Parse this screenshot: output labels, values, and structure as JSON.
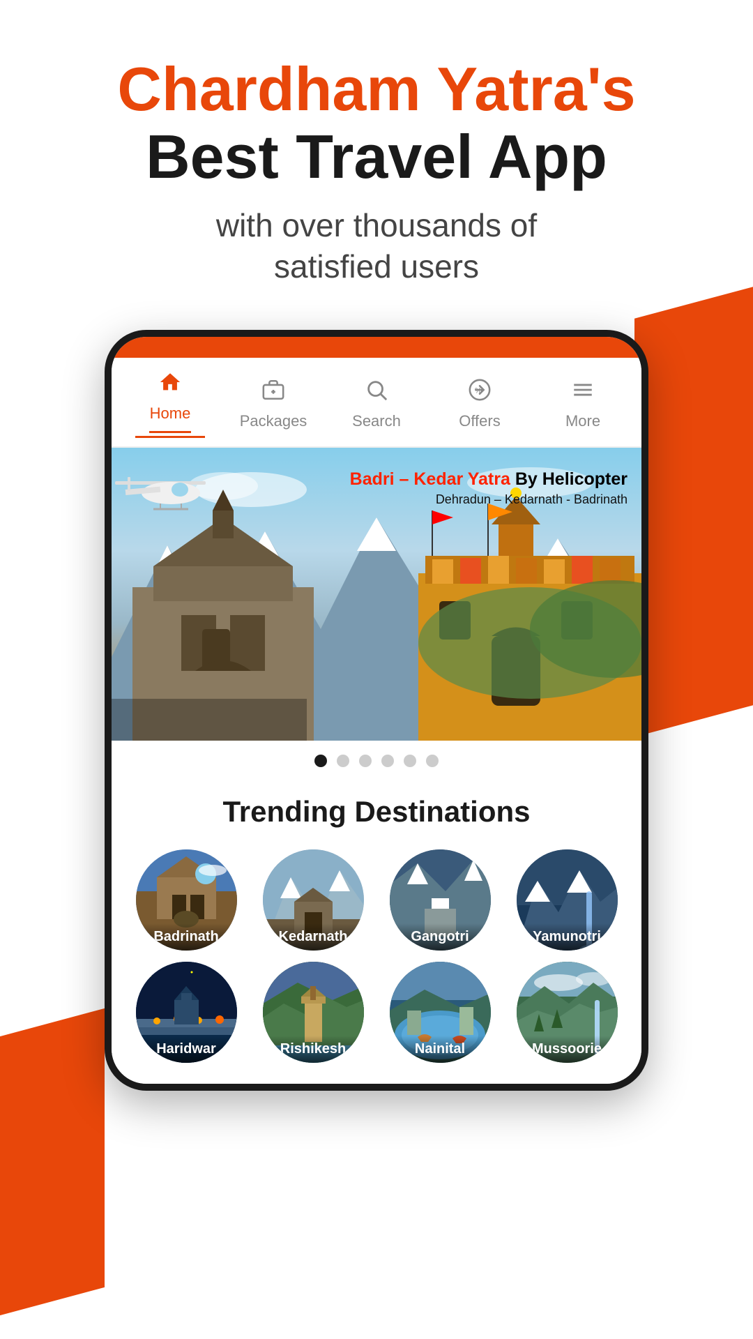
{
  "header": {
    "line1": "Chardham Yatra's",
    "line2": "Best Travel App",
    "subtitle": "with over thousands of\nsatisfied users"
  },
  "nav": {
    "items": [
      {
        "id": "home",
        "label": "Home",
        "icon": "🏠",
        "active": true
      },
      {
        "id": "packages",
        "label": "Packages",
        "icon": "🧳",
        "active": false
      },
      {
        "id": "search",
        "label": "Search",
        "icon": "🔍",
        "active": false
      },
      {
        "id": "offers",
        "label": "Offers",
        "icon": "🏷",
        "active": false
      },
      {
        "id": "more",
        "label": "More",
        "icon": "☰",
        "active": false
      }
    ]
  },
  "banner": {
    "title_red": "Badri – Kedar Yatra",
    "title_black": " By Helicopter",
    "subtitle": "Dehradun – Kedarnath - Badrinath"
  },
  "carousel": {
    "total_dots": 6,
    "active_dot": 0
  },
  "trending": {
    "title": "Trending Destinations",
    "destinations": [
      {
        "id": "badrinath",
        "label": "Badrinath",
        "row": 1
      },
      {
        "id": "kedarnath",
        "label": "Kedarnath",
        "row": 1
      },
      {
        "id": "gangotri",
        "label": "Gangotri",
        "row": 1
      },
      {
        "id": "yamunotri",
        "label": "Yamunotri",
        "row": 1
      },
      {
        "id": "haridwar",
        "label": "Haridwar",
        "row": 2
      },
      {
        "id": "rishikesh",
        "label": "Rishikesh",
        "row": 2
      },
      {
        "id": "nainital",
        "label": "Nainital",
        "row": 2
      },
      {
        "id": "mussoorie",
        "label": "Mussoorie",
        "row": 2
      }
    ]
  }
}
